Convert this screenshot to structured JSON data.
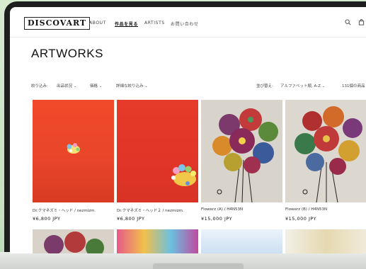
{
  "header": {
    "logo": "DISCOVART",
    "nav": [
      "ABOUT",
      "作品を見る",
      "ARTISTS",
      "お問い合わせ"
    ]
  },
  "page_title": "ARTWORKS",
  "filters": {
    "label": "絞り込み:",
    "items": [
      "出品状況",
      "価格",
      "詳細な絞り込み"
    ],
    "sort_label": "並び替え:",
    "sort_value": "アルファベット順, A-Z",
    "count": "131個の商品"
  },
  "products": [
    {
      "name": "Dr.クマネズミ・ヘッド / nezmizm.",
      "price": "¥6,800 JPY"
    },
    {
      "name": "Dr.クマネズミ・ヘッド２ / nezmizm.",
      "price": "¥6,800 JPY"
    },
    {
      "name": "Flowerz (A) / H4N53N",
      "price": "¥15,000 JPY"
    },
    {
      "name": "Flowerz (B) / H4N53N",
      "price": "¥15,000 JPY"
    }
  ],
  "colors": {
    "accent": "#111111",
    "red": "#e8452a",
    "bg_outer": "#cfe4c4"
  }
}
